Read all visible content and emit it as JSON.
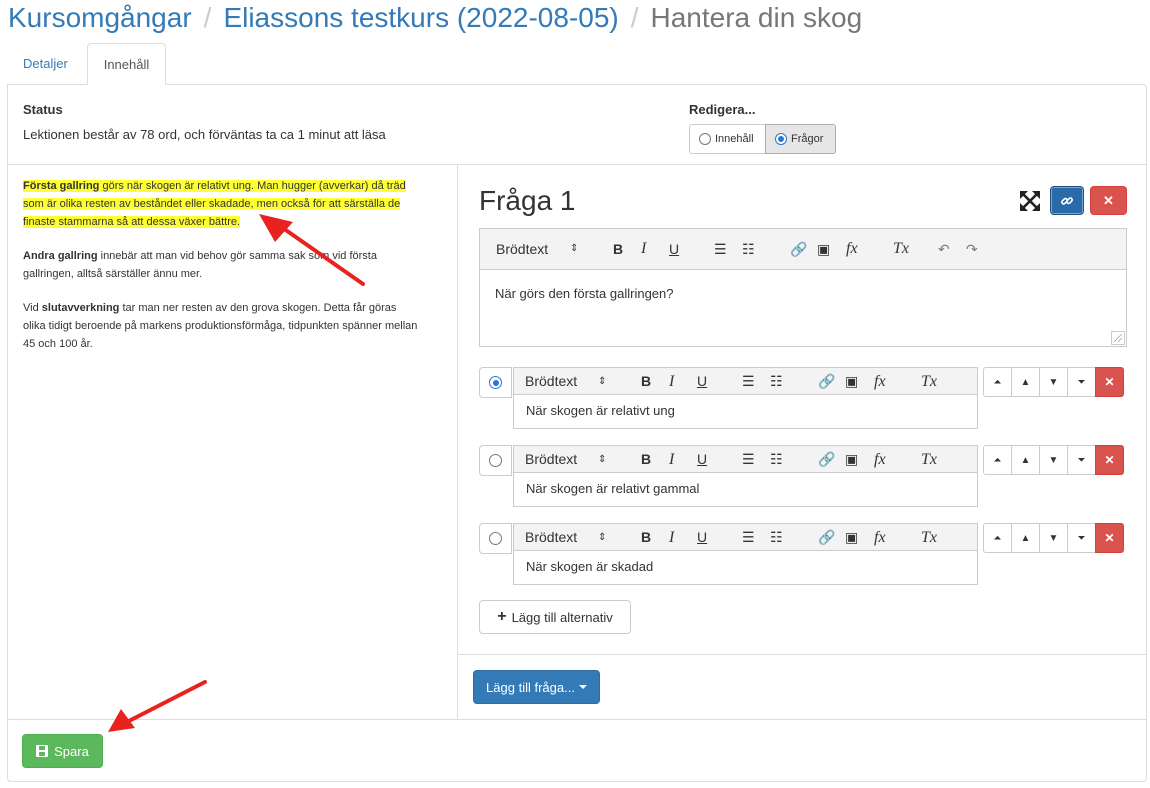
{
  "breadcrumb": {
    "root": "Kursomgångar",
    "course": "Eliassons testkurs (2022-08-05)",
    "current": "Hantera din skog",
    "separator": "/"
  },
  "tabs": [
    {
      "label": "Detaljer",
      "active": false
    },
    {
      "label": "Innehåll",
      "active": true
    }
  ],
  "status": {
    "title": "Status",
    "text": "Lektionen består av 78 ord, och förväntas ta ca 1 minut att läsa"
  },
  "edit_mode": {
    "title": "Redigera...",
    "options": [
      {
        "label": "Innehåll",
        "selected": false
      },
      {
        "label": "Frågor",
        "selected": true
      }
    ]
  },
  "lesson": {
    "p1_bold": "Första gallring",
    "p1_rest": " görs när skogen är relativt ung. Man hugger (avverkar) då träd som är olika resten av beståndet eller skadade, men också för att särställa de finaste stammarna så att dessa växer bättre.",
    "p2_bold": "Andra gallring",
    "p2_rest": " innebär att man vid behov gör samma sak som vid första gallringen, alltså särställer ännu mer.",
    "p3_pre": "Vid ",
    "p3_bold": "slutavverkning",
    "p3_rest": " tar man ner resten av den grova skogen. Detta får göras olika tidigt beroende på markens produktionsförmåga, tidpunkten spänner mellan 45 och 100 år."
  },
  "question": {
    "title": "Fråga 1",
    "toolbar_format": "Brödtext",
    "text": "När görs den första gallringen?",
    "answers": [
      {
        "text": "När skogen är relativt ung",
        "selected": true
      },
      {
        "text": "När skogen är relativt gammal",
        "selected": false
      },
      {
        "text": "När skogen är skadad",
        "selected": false
      }
    ]
  },
  "toolbar": {
    "bold": "B",
    "italic": "I",
    "underline": "U"
  },
  "buttons": {
    "add_alternative": "Lägg till alternativ",
    "add_question": "Lägg till fråga...",
    "save": "Spara",
    "delete": "✕"
  },
  "colors": {
    "highlight": "#ffff33",
    "primary": "#337ab7",
    "danger": "#d9534f",
    "success": "#5cb85c",
    "annotation_arrow": "#e8231f"
  }
}
